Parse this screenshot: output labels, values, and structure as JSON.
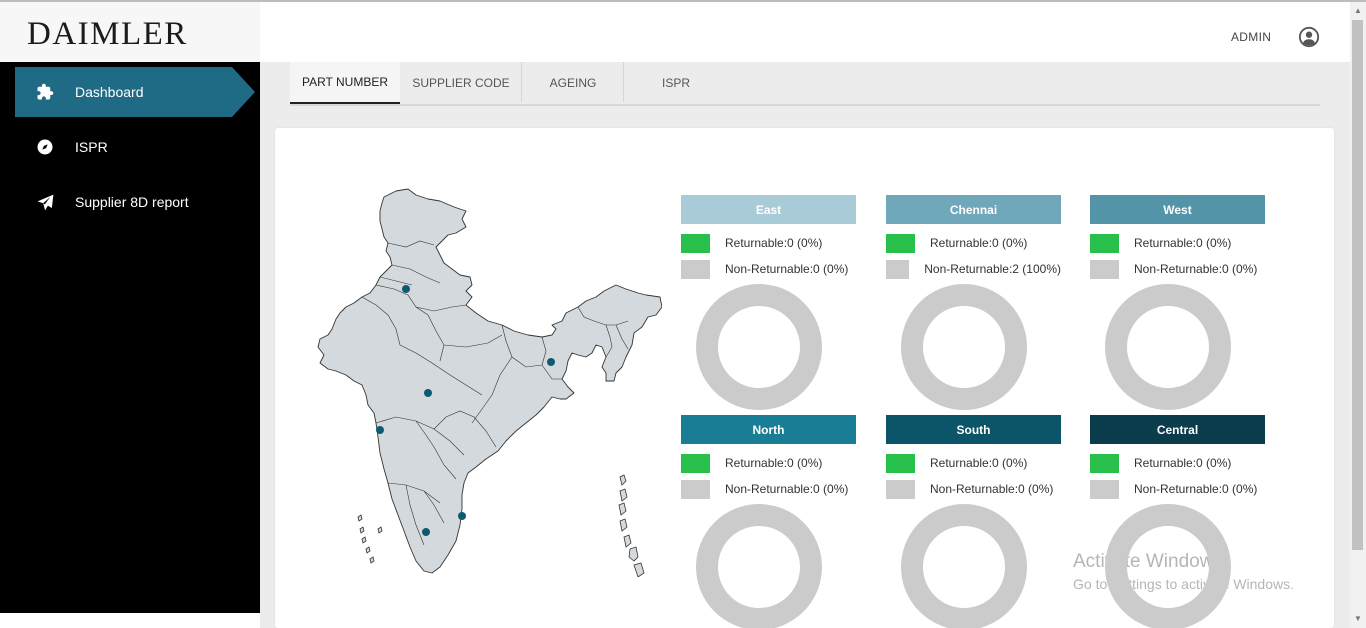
{
  "brand": {
    "logo_text": "DAIMLER"
  },
  "header": {
    "user_name": "ADMIN",
    "user_icon": "account-circle-icon"
  },
  "sidebar": {
    "items": [
      {
        "label": "Dashboard",
        "icon": "puzzle-icon",
        "active": true
      },
      {
        "label": "ISPR",
        "icon": "compass-icon",
        "active": false
      },
      {
        "label": "Supplier 8D report",
        "icon": "paper-plane-icon",
        "active": false
      }
    ]
  },
  "tabs": [
    {
      "label": "PART NUMBER",
      "active": true
    },
    {
      "label": "SUPPLIER CODE",
      "active": false
    },
    {
      "label": "AGEING",
      "active": false
    },
    {
      "label": "ISPR",
      "active": false
    }
  ],
  "colors": {
    "returnable": "#28c04a",
    "non_returnable": "#cbcbcb",
    "donut_empty": "#cbcbcb",
    "map_fill": "#d3d9dc",
    "map_marker": "#0d5a72"
  },
  "regions": [
    {
      "name": "East",
      "color": "#a9cbd8",
      "returnable": "Returnable:0 (0%)",
      "non_returnable": "Non-Returnable:0 (0%)",
      "returnable_pct": 0,
      "non_returnable_pct": 0
    },
    {
      "name": "Chennai",
      "color": "#6ea8ba",
      "returnable": "Returnable:0 (0%)",
      "non_returnable": "Non-Returnable:2 (100%)",
      "returnable_pct": 0,
      "non_returnable_pct": 100
    },
    {
      "name": "West",
      "color": "#5494a8",
      "returnable": "Returnable:0 (0%)",
      "non_returnable": "Non-Returnable:0 (0%)",
      "returnable_pct": 0,
      "non_returnable_pct": 0
    },
    {
      "name": "North",
      "color": "#1a7d96",
      "returnable": "Returnable:0 (0%)",
      "non_returnable": "Non-Returnable:0 (0%)",
      "returnable_pct": 0,
      "non_returnable_pct": 0
    },
    {
      "name": "South",
      "color": "#0c5468",
      "returnable": "Returnable:0 (0%)",
      "non_returnable": "Non-Returnable:0 (0%)",
      "returnable_pct": 0,
      "non_returnable_pct": 0
    },
    {
      "name": "Central",
      "color": "#0b3c4c",
      "returnable": "Returnable:0 (0%)",
      "non_returnable": "Non-Returnable:0 (0%)",
      "returnable_pct": 0,
      "non_returnable_pct": 0
    }
  ],
  "watermark": {
    "title": "Activate Windows",
    "subtitle": "Go to Settings to activate Windows."
  }
}
